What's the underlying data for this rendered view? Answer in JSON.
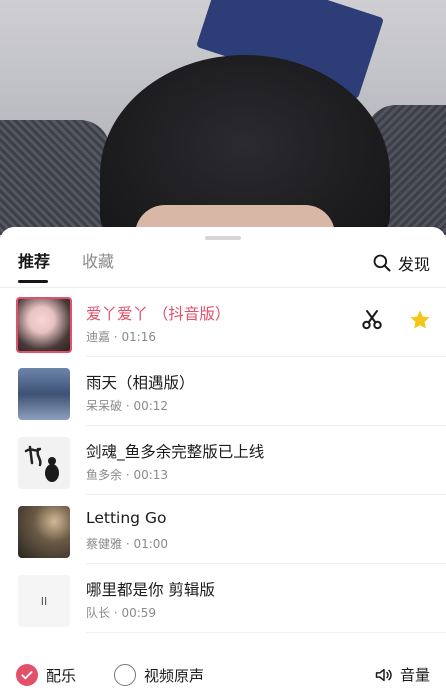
{
  "tabs": [
    {
      "label": "推荐",
      "active": true
    },
    {
      "label": "收藏",
      "active": false
    }
  ],
  "discover_label": "发现",
  "songs": [
    {
      "title": "爱丫爱丫 （抖音版）",
      "artist": "迪嘉",
      "duration": "01:16",
      "selected": true,
      "cover_icon": "cover-art-girl"
    },
    {
      "title": "雨天（相遇版）",
      "artist": "呆呆破",
      "duration": "00:12",
      "selected": false,
      "cover_icon": "cover-art-night-sky"
    },
    {
      "title": "剑魂_鱼多余完整版已上线",
      "artist": "鱼多余",
      "duration": "00:13",
      "selected": false,
      "cover_icon": "cover-art-ink-calligraphy"
    },
    {
      "title": "Letting Go",
      "artist": "蔡健雅",
      "duration": "01:00",
      "selected": false,
      "cover_icon": "cover-art-portrait"
    },
    {
      "title": "哪里都是你 剪辑版",
      "artist": "队长",
      "duration": "00:59",
      "selected": false,
      "cover_icon": "cover-art-minimal"
    }
  ],
  "cover5_text": "II",
  "bottom": {
    "music_label": "配乐",
    "music_checked": true,
    "original_label": "视频原声",
    "original_checked": false,
    "volume_label": "音量"
  },
  "colors": {
    "accent": "#e3506a",
    "star": "#f5c518"
  }
}
